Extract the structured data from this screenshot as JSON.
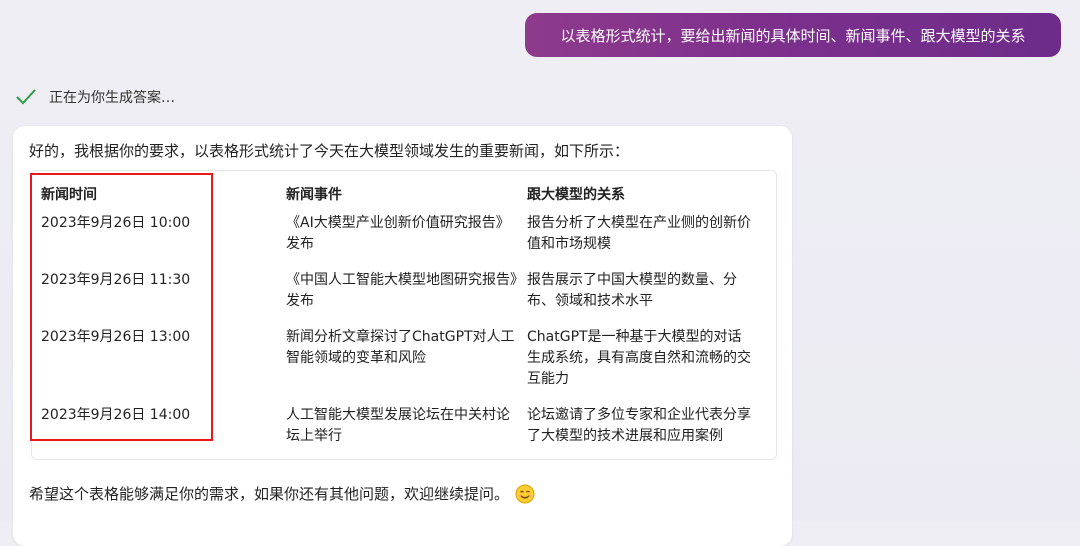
{
  "user_message": "以表格形式统计，要给出新闻的具体时间、新闻事件、跟大模型的关系",
  "status": {
    "text": "正在为你生成答案…",
    "icon": "check-icon"
  },
  "answer": {
    "intro": "好的，我根据你的要求，以表格形式统计了今天在大模型领域发生的重要新闻，如下所示：",
    "table": {
      "headers": [
        "新闻时间",
        "新闻事件",
        "跟大模型的关系"
      ],
      "rows": [
        [
          "2023年9月26日 10:00",
          "《AI大模型产业创新价值研究报告》发布",
          "报告分析了大模型在产业侧的创新价值和市场规模"
        ],
        [
          "2023年9月26日 11:30",
          "《中国人工智能大模型地图研究报告》发布",
          "报告展示了中国大模型的数量、分布、领域和技术水平"
        ],
        [
          "2023年9月26日 13:00",
          "新闻分析文章探讨了ChatGPT对人工智能领域的变革和风险",
          "ChatGPT是一种基于大模型的对话生成系统，具有高度自然和流畅的交互能力"
        ],
        [
          "2023年9月26日 14:00",
          "人工智能大模型发展论坛在中关村论坛上举行",
          "论坛邀请了多位专家和企业代表分享了大模型的技术进展和应用案例"
        ]
      ]
    },
    "closing": "希望这个表格能够满足你的需求，如果你还有其他问题，欢迎继续提问。",
    "closing_emoji": "smile-emoji-icon"
  },
  "colors": {
    "user_bubble": "#7b2f8c",
    "highlight_box": "#e8191d",
    "check": "#2e9e44"
  }
}
